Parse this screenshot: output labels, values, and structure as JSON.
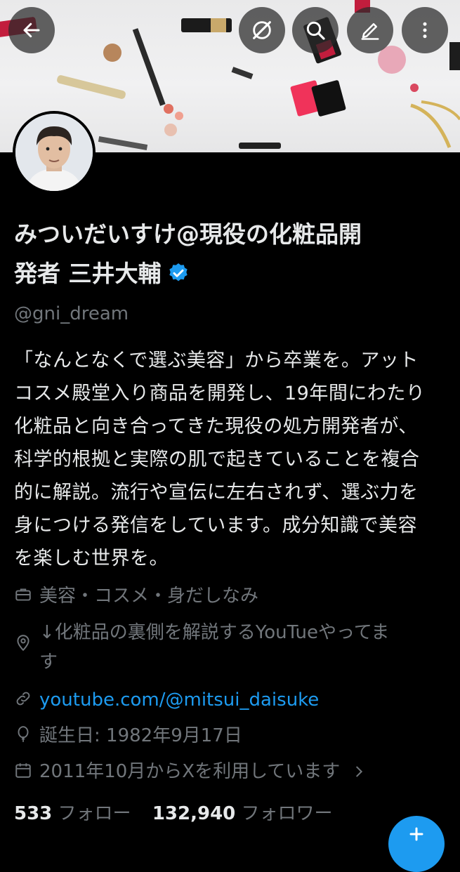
{
  "header": {
    "back_icon": "arrow-left-icon",
    "icons": [
      "grok-icon",
      "search-icon",
      "edit-icon",
      "more-vertical-icon"
    ]
  },
  "profile": {
    "name": "みついだいすけ@現役の化粧品開発者 三井大輔",
    "name_line1": "みついだいすけ@現役の化粧品開",
    "name_line2": "発者 三井大輔",
    "handle": "@gni_dream",
    "bio": [
      "「なんとなくで選ぶ美容」から卒業を。アット",
      "コスメ殿堂入り商品を開発し、19年間にわたり",
      "化粧品と向き合ってきた現役の処方開発者が、",
      "科学的根拠と実際の肌で起きていることを複合",
      "的に解説。流行や宣伝に左右されず、選ぶ力を",
      "身につける発信をしています。成分知識で美容",
      "を楽しむ世界を。"
    ],
    "category": "美容・コスメ・身だしなみ",
    "location_line1": "↓化粧品の裏側を解説するYouTueやってま",
    "location_line2": "す",
    "website": "youtube.com/@mitsui_daisuke",
    "birthday": "誕生日: 1982年9月17日",
    "joined": "2011年10月からXを利用しています",
    "following_count": "533",
    "following_label": "フォロー",
    "followers_count": "132,940",
    "followers_label": "フォロワー"
  },
  "colors": {
    "accent": "#1d9bf0",
    "muted": "#71767b",
    "text": "#e7e9ea",
    "background": "#000000"
  }
}
